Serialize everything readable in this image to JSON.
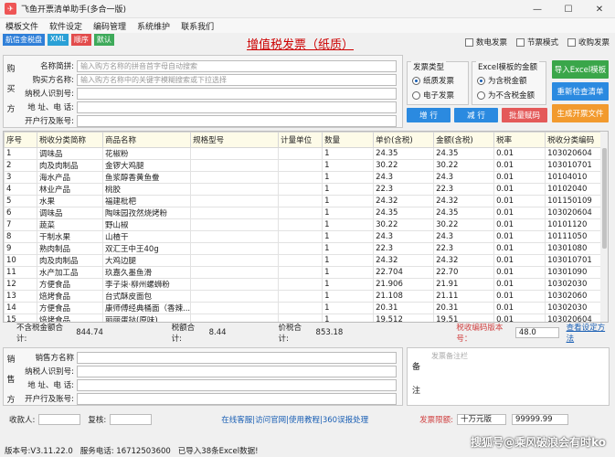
{
  "window": {
    "title": "飞鱼开票清单助手(多合一版)",
    "icon": "app-icon"
  },
  "menu": [
    "模板文件",
    "软件设定",
    "编码管理",
    "系统维护",
    "联系我们"
  ],
  "tags": [
    {
      "label": "航信金税盘",
      "color": "#2f7fd8"
    },
    {
      "label": "XML",
      "color": "#2aa0d6"
    },
    {
      "label": "顺序",
      "color": "#e24c4c"
    },
    {
      "label": "默认",
      "color": "#3eaa5a"
    }
  ],
  "heading": "增值税发票（纸质）",
  "mode_checks": [
    "数电发票",
    "节票模式",
    "收购发票"
  ],
  "buyer": {
    "side_label": [
      "购",
      "买",
      "方"
    ],
    "rows": [
      {
        "label": "名称简拼:",
        "value": "输入购方名称的拼音首字母自动搜索"
      },
      {
        "label": "购买方名称:",
        "value": "输入购方名称中的关键字模糊搜索或下拉选择"
      },
      {
        "label": "纳税人识别号:",
        "value": ""
      },
      {
        "label": "地  址、电 话:",
        "value": ""
      },
      {
        "label": "开户行及账号:",
        "value": ""
      }
    ]
  },
  "invoice_type": {
    "title": "发票类型",
    "options": [
      "纸质发票",
      "电子发票"
    ],
    "selected": 0
  },
  "excel_amount": {
    "title": "Excel模板的金额",
    "options": [
      "为含税金额",
      "为不含税金额"
    ],
    "selected": 0
  },
  "action_buttons": {
    "import": "导入Excel模板",
    "recheck": "重新检查清单",
    "add": "增 行",
    "remove": "减 行",
    "batch": "批量赋码",
    "generate": "生成开票文件"
  },
  "table": {
    "headers": [
      "序号",
      "税收分类简称",
      "商品名称",
      "规格型号",
      "计量单位",
      "数量",
      "单价(含税)",
      "金额(含税)",
      "税率",
      "税收分类编码"
    ],
    "rows": [
      [
        "1",
        "调味品",
        "花椒粉",
        "",
        "",
        "1",
        "24.35",
        "24.35",
        "0.01",
        "103020604"
      ],
      [
        "2",
        "肉及肉制品",
        "金锣大鸡腿",
        "",
        "",
        "1",
        "30.22",
        "30.22",
        "0.01",
        "103010701"
      ],
      [
        "3",
        "海水产品",
        "鱼浆醇香黄鱼鲞",
        "",
        "",
        "1",
        "24.3",
        "24.3",
        "0.01",
        "10104010"
      ],
      [
        "4",
        "林业产品",
        "桃胶",
        "",
        "",
        "1",
        "22.3",
        "22.3",
        "0.01",
        "10102040"
      ],
      [
        "5",
        "水果",
        "福建枇杷",
        "",
        "",
        "1",
        "24.32",
        "24.32",
        "0.01",
        "101150109"
      ],
      [
        "6",
        "调味品",
        "陶味园孜然烧烤粉",
        "",
        "",
        "1",
        "24.35",
        "24.35",
        "0.01",
        "103020604"
      ],
      [
        "7",
        "蔬菜",
        "野山椒",
        "",
        "",
        "1",
        "30.22",
        "30.22",
        "0.01",
        "10101120"
      ],
      [
        "8",
        "干制水果",
        "山楂干",
        "",
        "",
        "1",
        "24.3",
        "24.3",
        "0.01",
        "10111050"
      ],
      [
        "9",
        "熟肉制品",
        "双汇王中王40g",
        "",
        "",
        "1",
        "22.3",
        "22.3",
        "0.01",
        "10301080"
      ],
      [
        "10",
        "肉及肉制品",
        "大鸡边腿",
        "",
        "",
        "1",
        "24.32",
        "24.32",
        "0.01",
        "103010701"
      ],
      [
        "11",
        "水产加工品",
        "玖嘉久墨鱼滑",
        "",
        "",
        "1",
        "22.704",
        "22.70",
        "0.01",
        "10301090"
      ],
      [
        "12",
        "方便食品",
        "李子柒·柳州螺蛳粉",
        "",
        "",
        "1",
        "21.906",
        "21.91",
        "0.01",
        "10302030"
      ],
      [
        "13",
        "焙烤食品",
        "台式酥皮面包",
        "",
        "",
        "1",
        "21.108",
        "21.11",
        "0.01",
        "10302060"
      ],
      [
        "14",
        "方便食品",
        "康师傅经典桶面（香辣...",
        "",
        "",
        "1",
        "20.31",
        "20.31",
        "0.01",
        "10302030"
      ],
      [
        "15",
        "焙烤食品",
        "丽丽蛋挞(原味)",
        "",
        "",
        "1",
        "19.512",
        "19.51",
        "0.01",
        "103020604"
      ]
    ]
  },
  "totals": {
    "net_label": "不含税金额合计:",
    "net": "844.74",
    "tax_label": "税额合计:",
    "tax": "8.44",
    "gross_label": "价税合计:",
    "gross": "853.18",
    "code_version_label": "税收编码版本号：",
    "code_version": "48.0",
    "setup_link": "查看设定方法"
  },
  "seller": {
    "side_label": [
      "销",
      "售",
      "方"
    ],
    "rows": [
      {
        "label": "销售方名称",
        "value": ""
      },
      {
        "label": "纳税人识别号:",
        "value": ""
      },
      {
        "label": "地 址、电 话:",
        "value": ""
      },
      {
        "label": "开户行及账号:",
        "value": ""
      }
    ]
  },
  "remark": {
    "side_label": [
      "备",
      "注"
    ],
    "placeholder": "发票备注栏"
  },
  "footer": {
    "payee_label": "收款人:",
    "reviewer_label": "复核:",
    "links": "在线客服|访问官网|使用教程|360误报处理",
    "limit_label": "发票限额:",
    "limit_select": "十万元版",
    "limit_value": "99999.99"
  },
  "status": {
    "version": "版本号:V3.11.22.0",
    "service": "服务电话: 16712503600",
    "imported": "已导入38条Excel数据!"
  },
  "watermark": "搜狐号@乘风破浪会有时ko"
}
